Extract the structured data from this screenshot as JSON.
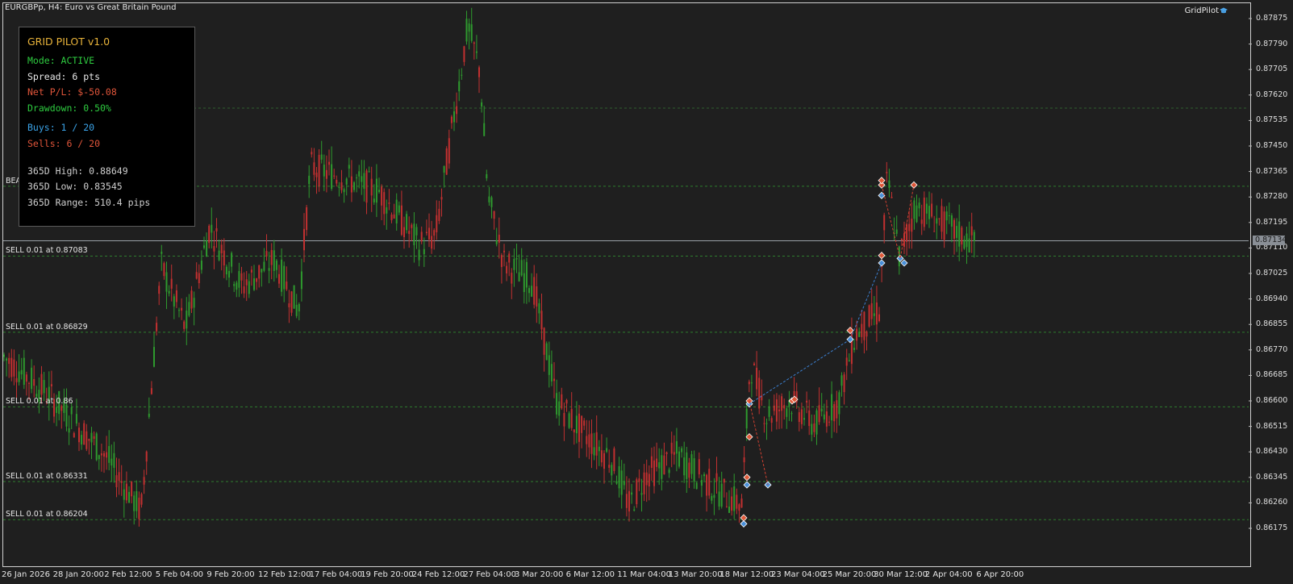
{
  "chart": {
    "symbol_title": "EURGBPp, H4:  Euro vs Great Britain Pound",
    "brand_name": "GridPilot",
    "current_price": "0.87134",
    "price_scale": [
      "0.87875",
      "0.87790",
      "0.87705",
      "0.87620",
      "0.87535",
      "0.87450",
      "0.87365",
      "0.87280",
      "0.87195",
      "0.87110",
      "0.87025",
      "0.86940",
      "0.86855",
      "0.86770",
      "0.86685",
      "0.86600",
      "0.86515",
      "0.86430",
      "0.86345",
      "0.86260",
      "0.86175"
    ],
    "time_axis": [
      "26 Jan 2026",
      "28 Jan 20:00",
      "2 Feb 12:00",
      "5 Feb 04:00",
      "9 Feb 20:00",
      "12 Feb 12:00",
      "17 Feb 04:00",
      "19 Feb 20:00",
      "24 Feb 12:00",
      "27 Feb 04:00",
      "3 Mar 20:00",
      "6 Mar 12:00",
      "11 Mar 04:00",
      "13 Mar 20:00",
      "18 Mar 12:00",
      "23 Mar 04:00",
      "25 Mar 20:00",
      "30 Mar 12:00",
      "2 Apr 04:00",
      "6 Apr 20:00"
    ],
    "colors": {
      "bull": "#2e9a2e",
      "bear": "#c23030",
      "grid_level": "#2f7d2f",
      "buy_marker": "#4a90d9",
      "sell_marker": "#e05a3a"
    }
  },
  "grid_levels": [
    {
      "label": "BEA",
      "price": 0.87316
    },
    {
      "label": "SELL 0.01 at 0.87083",
      "price": 0.87083
    },
    {
      "label": "SELL 0.01 at 0.86829",
      "price": 0.86829
    },
    {
      "label": "SELL 0.01 at 0.86",
      "price": 0.8658
    },
    {
      "label": "SELL 0.01 at 0.86331",
      "price": 0.86331
    },
    {
      "label": "SELL 0.01 at 0.86204",
      "price": 0.86204
    }
  ],
  "panel": {
    "title": "GRID PILOT v1.0",
    "mode": "Mode: ACTIVE",
    "spread": "Spread: 6 pts",
    "net_pl": "Net P/L: $-50.08",
    "drawdown": "Drawdown: 0.50%",
    "buys": "Buys: 1 / 20",
    "sells": "Sells: 6 / 20",
    "high_365": "365D High: 0.88649",
    "low_365": "365D Low: 0.83545",
    "range_365": "365D Range: 510.4 pips",
    "colors": {
      "title": "#e8b33a",
      "active": "#2ecc40",
      "white": "#e8e8e8",
      "loss": "#e0553a",
      "buys": "#3ba3e8",
      "sells": "#e0553a",
      "muted": "#cfcfcf"
    }
  }
}
